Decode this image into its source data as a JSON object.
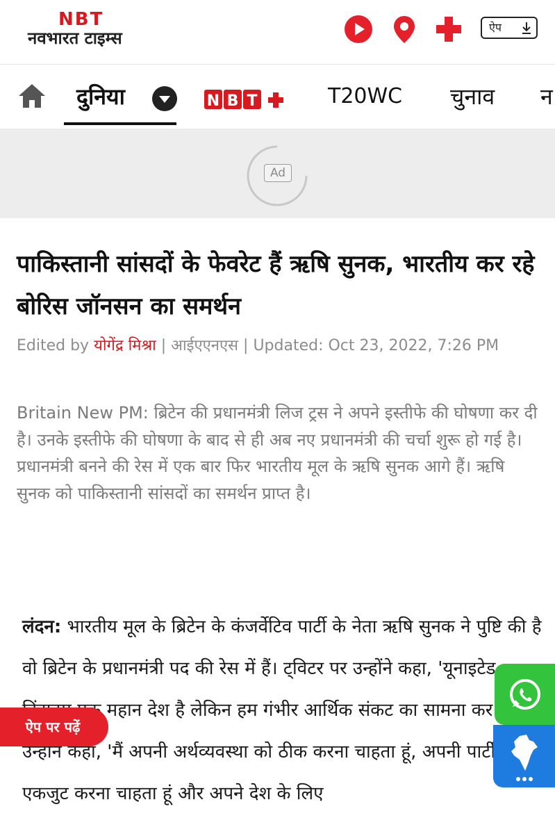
{
  "header": {
    "logo_brand": "NBT",
    "logo_name": "नवभारत टाइम्स",
    "app_button_label": "ऐप",
    "icons": [
      "play-icon",
      "location-pin-icon",
      "plus-icon",
      "download-icon"
    ]
  },
  "nav": {
    "items": [
      "दुनिया",
      "NBT+",
      "T20WC",
      "चुनाव",
      "न"
    ],
    "active": "दुनिया"
  },
  "ad": {
    "label": "Ad"
  },
  "article": {
    "headline": "पाकिस्तानी सांसदों के फेवरेट हैं ऋषि सुनक, भारतीय कर रहे बोरिस जॉनसन का समर्थन",
    "edited_by_label": "Edited by",
    "author": "योगेंद्र मिश्रा",
    "source": "आईएएनएस",
    "updated": "Updated: Oct 23, 2022, 7:26 PM",
    "summary": "Britain New PM: ब्रिटेन की प्रधानमंत्री लिज ट्रस ने अपने इस्तीफे की घोषणा कर दी है। उनके इस्तीफे की घोषणा के बाद से ही अब नए प्रधानमंत्री की चर्चा शुरू हो गई है। प्रधानमंत्री बनने की रेस में एक बार फिर भारतीय मूल के ऋषि सुनक आगे हैं। ऋषि सुनक को पाकिस्तानी सांसदों का समर्थन प्राप्त है।",
    "place": "लंदन:",
    "body": "भारतीय मूल के ब्रिटेन के कंजर्वेटिव पार्टी के नेता ऋषि सुनक ने पुष्टि की है वो ब्रिटेन के प्रधानमंत्री पद की रेस में हैं। ट्विटर पर उन्होंने कहा, 'यूनाइटेड किंगडम एक महान देश है लेकिन हम गंभीर आर्थिक संकट का सामना कर रहे हैं।' उन्होंने कहा, 'मैं अपनी अर्थव्यवस्था को ठीक करना चाहता हूं, अपनी पार्टी को एकजुट करना चाहता हूं और अपने देश के लिए"
  },
  "floating": {
    "app_read_label": "ऐप पर पढ़ें",
    "whatsapp_icon": "whatsapp-icon",
    "india_icon": "india-map-icon"
  },
  "colors": {
    "brand_red": "#d71920",
    "whatsapp_green": "#34c33d",
    "india_blue": "#1e7be0"
  }
}
